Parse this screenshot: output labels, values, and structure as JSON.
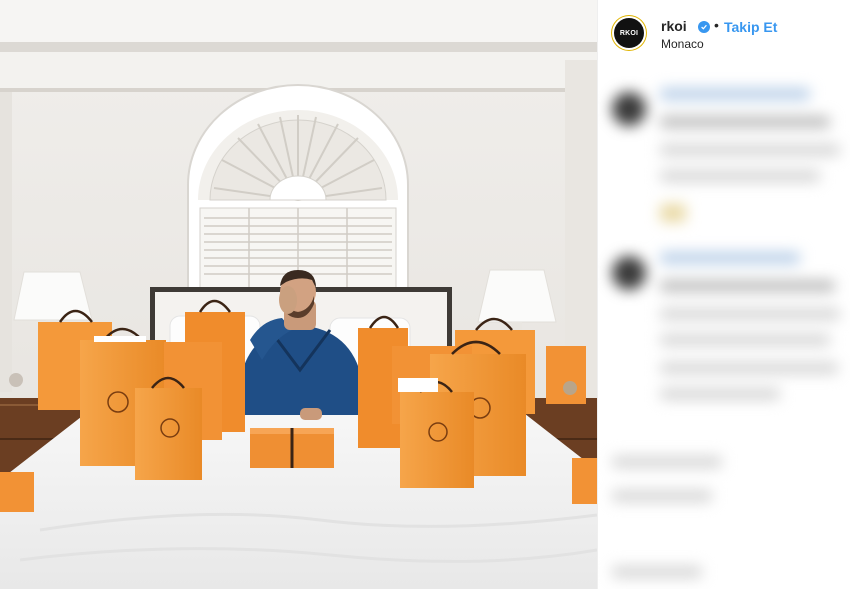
{
  "post": {
    "username": "rkoi",
    "avatar_text": "RKOI",
    "follow_label": "Takip Et",
    "separator": "•",
    "location": "Monaco"
  },
  "icons": {
    "verified": "verified-badge-icon"
  },
  "colors": {
    "link_blue": "#3897f0",
    "bag_orange": "#f39a3a",
    "text_dark": "#262626"
  }
}
